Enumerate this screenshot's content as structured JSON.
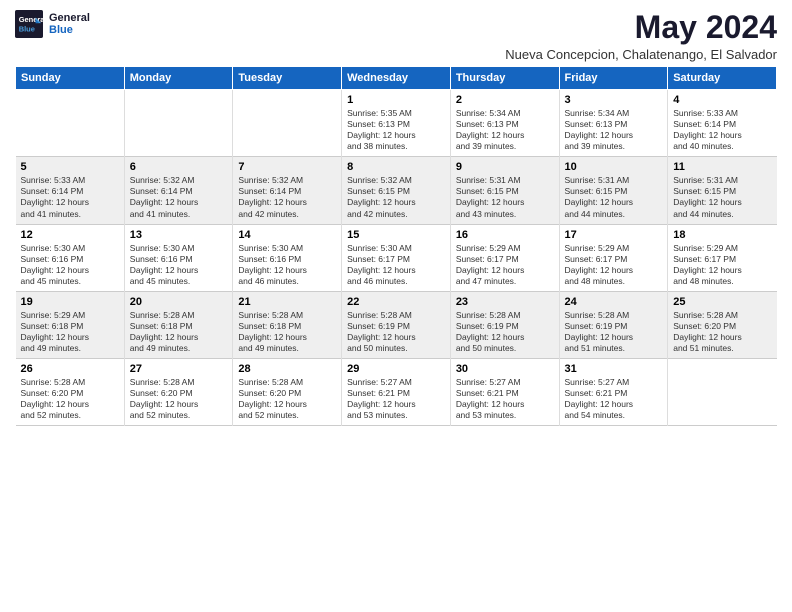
{
  "logo": {
    "line1": "General",
    "line2": "Blue"
  },
  "title": "May 2024",
  "subtitle": "Nueva Concepcion, Chalatenango, El Salvador",
  "days_header": [
    "Sunday",
    "Monday",
    "Tuesday",
    "Wednesday",
    "Thursday",
    "Friday",
    "Saturday"
  ],
  "weeks": [
    [
      {
        "num": "",
        "info": ""
      },
      {
        "num": "",
        "info": ""
      },
      {
        "num": "",
        "info": ""
      },
      {
        "num": "1",
        "info": "Sunrise: 5:35 AM\nSunset: 6:13 PM\nDaylight: 12 hours\nand 38 minutes."
      },
      {
        "num": "2",
        "info": "Sunrise: 5:34 AM\nSunset: 6:13 PM\nDaylight: 12 hours\nand 39 minutes."
      },
      {
        "num": "3",
        "info": "Sunrise: 5:34 AM\nSunset: 6:13 PM\nDaylight: 12 hours\nand 39 minutes."
      },
      {
        "num": "4",
        "info": "Sunrise: 5:33 AM\nSunset: 6:14 PM\nDaylight: 12 hours\nand 40 minutes."
      }
    ],
    [
      {
        "num": "5",
        "info": "Sunrise: 5:33 AM\nSunset: 6:14 PM\nDaylight: 12 hours\nand 41 minutes."
      },
      {
        "num": "6",
        "info": "Sunrise: 5:32 AM\nSunset: 6:14 PM\nDaylight: 12 hours\nand 41 minutes."
      },
      {
        "num": "7",
        "info": "Sunrise: 5:32 AM\nSunset: 6:14 PM\nDaylight: 12 hours\nand 42 minutes."
      },
      {
        "num": "8",
        "info": "Sunrise: 5:32 AM\nSunset: 6:15 PM\nDaylight: 12 hours\nand 42 minutes."
      },
      {
        "num": "9",
        "info": "Sunrise: 5:31 AM\nSunset: 6:15 PM\nDaylight: 12 hours\nand 43 minutes."
      },
      {
        "num": "10",
        "info": "Sunrise: 5:31 AM\nSunset: 6:15 PM\nDaylight: 12 hours\nand 44 minutes."
      },
      {
        "num": "11",
        "info": "Sunrise: 5:31 AM\nSunset: 6:15 PM\nDaylight: 12 hours\nand 44 minutes."
      }
    ],
    [
      {
        "num": "12",
        "info": "Sunrise: 5:30 AM\nSunset: 6:16 PM\nDaylight: 12 hours\nand 45 minutes."
      },
      {
        "num": "13",
        "info": "Sunrise: 5:30 AM\nSunset: 6:16 PM\nDaylight: 12 hours\nand 45 minutes."
      },
      {
        "num": "14",
        "info": "Sunrise: 5:30 AM\nSunset: 6:16 PM\nDaylight: 12 hours\nand 46 minutes."
      },
      {
        "num": "15",
        "info": "Sunrise: 5:30 AM\nSunset: 6:17 PM\nDaylight: 12 hours\nand 46 minutes."
      },
      {
        "num": "16",
        "info": "Sunrise: 5:29 AM\nSunset: 6:17 PM\nDaylight: 12 hours\nand 47 minutes."
      },
      {
        "num": "17",
        "info": "Sunrise: 5:29 AM\nSunset: 6:17 PM\nDaylight: 12 hours\nand 48 minutes."
      },
      {
        "num": "18",
        "info": "Sunrise: 5:29 AM\nSunset: 6:17 PM\nDaylight: 12 hours\nand 48 minutes."
      }
    ],
    [
      {
        "num": "19",
        "info": "Sunrise: 5:29 AM\nSunset: 6:18 PM\nDaylight: 12 hours\nand 49 minutes."
      },
      {
        "num": "20",
        "info": "Sunrise: 5:28 AM\nSunset: 6:18 PM\nDaylight: 12 hours\nand 49 minutes."
      },
      {
        "num": "21",
        "info": "Sunrise: 5:28 AM\nSunset: 6:18 PM\nDaylight: 12 hours\nand 49 minutes."
      },
      {
        "num": "22",
        "info": "Sunrise: 5:28 AM\nSunset: 6:19 PM\nDaylight: 12 hours\nand 50 minutes."
      },
      {
        "num": "23",
        "info": "Sunrise: 5:28 AM\nSunset: 6:19 PM\nDaylight: 12 hours\nand 50 minutes."
      },
      {
        "num": "24",
        "info": "Sunrise: 5:28 AM\nSunset: 6:19 PM\nDaylight: 12 hours\nand 51 minutes."
      },
      {
        "num": "25",
        "info": "Sunrise: 5:28 AM\nSunset: 6:20 PM\nDaylight: 12 hours\nand 51 minutes."
      }
    ],
    [
      {
        "num": "26",
        "info": "Sunrise: 5:28 AM\nSunset: 6:20 PM\nDaylight: 12 hours\nand 52 minutes."
      },
      {
        "num": "27",
        "info": "Sunrise: 5:28 AM\nSunset: 6:20 PM\nDaylight: 12 hours\nand 52 minutes."
      },
      {
        "num": "28",
        "info": "Sunrise: 5:28 AM\nSunset: 6:20 PM\nDaylight: 12 hours\nand 52 minutes."
      },
      {
        "num": "29",
        "info": "Sunrise: 5:27 AM\nSunset: 6:21 PM\nDaylight: 12 hours\nand 53 minutes."
      },
      {
        "num": "30",
        "info": "Sunrise: 5:27 AM\nSunset: 6:21 PM\nDaylight: 12 hours\nand 53 minutes."
      },
      {
        "num": "31",
        "info": "Sunrise: 5:27 AM\nSunset: 6:21 PM\nDaylight: 12 hours\nand 54 minutes."
      },
      {
        "num": "",
        "info": ""
      }
    ]
  ],
  "colors": {
    "header_bg": "#1565c0",
    "header_text": "#ffffff",
    "row_even_bg": "#efefef",
    "row_odd_bg": "#ffffff"
  }
}
